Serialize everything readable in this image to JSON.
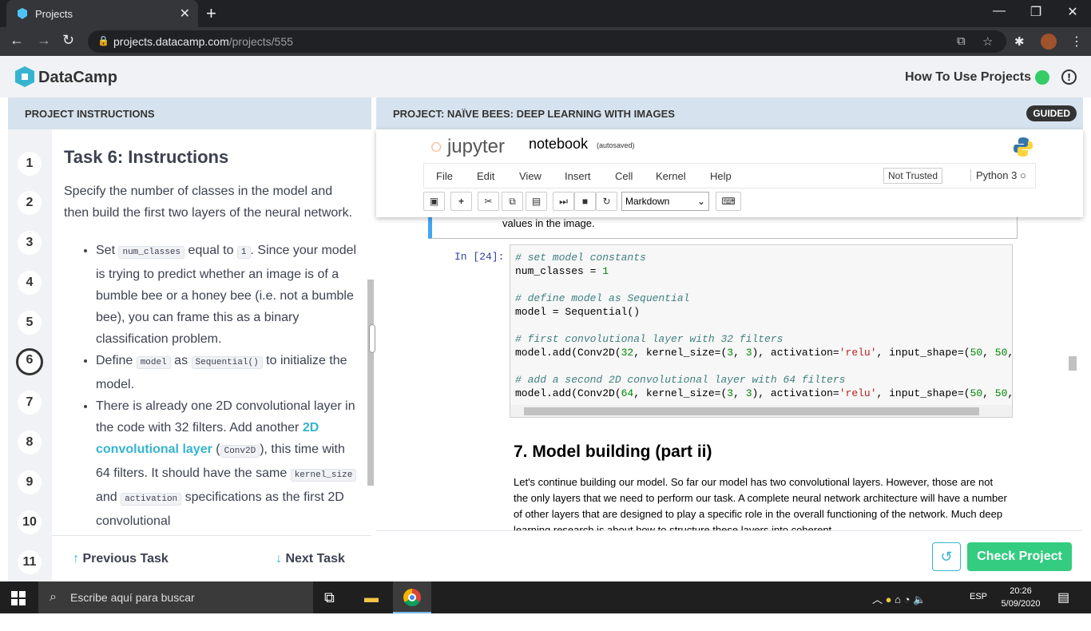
{
  "browser": {
    "tab_title": "Projects",
    "url_host": "projects.datacamp.com",
    "url_path": "/projects/555"
  },
  "header": {
    "brand": "DataCamp",
    "how_to": "How To Use Projects"
  },
  "left_panel": {
    "title": "PROJECT INSTRUCTIONS",
    "steps": [
      "1",
      "2",
      "3",
      "4",
      "5",
      "6",
      "7",
      "8",
      "9",
      "10",
      "11"
    ],
    "active_step": "6",
    "task_title": "Task 6: Instructions",
    "intro": "Specify the number of classes in the model and then build the first two layers of the neural network.",
    "bullets": {
      "b1_pre": "Set ",
      "b1_code1": "num_classes",
      "b1_mid": " equal to ",
      "b1_code2": "1",
      "b1_post": ". Since your model is trying to predict whether an image is of a bumble bee or a honey bee (i.e. not a bumble bee), you can frame this as a binary classification problem.",
      "b2_pre": "Define ",
      "b2_code1": "model",
      "b2_mid": " as ",
      "b2_code2": "Sequential()",
      "b2_post": " to initialize the model.",
      "b3_pre": "There is already one 2D convolutional layer in the code with 32 filters. Add another ",
      "b3_link": "2D convolutional layer",
      "b3_paren1": " (",
      "b3_code1": "Conv2D",
      "b3_mid": "), this time with 64 filters. It should have the same ",
      "b3_code2": "kernel_size",
      "b3_and": " and ",
      "b3_code3": "activation",
      "b3_post": " specifications as the first 2D convolutional"
    },
    "prev_label": "Previous Task",
    "next_label": "Next Task"
  },
  "right_panel": {
    "title": "PROJECT: NAÏVE BEES: DEEP LEARNING WITH IMAGES",
    "badge": "GUIDED",
    "jupyter": {
      "logo_text": "jupyter",
      "notebook_name": "notebook",
      "autosaved": "(autosaved)",
      "menu": [
        "File",
        "Edit",
        "View",
        "Insert",
        "Cell",
        "Kernel",
        "Help"
      ],
      "trusted": "Not Trusted",
      "kernel": "Python 3",
      "cell_type": "Markdown"
    },
    "prev_cell_text": "values in the image.",
    "prompt": "In [24]:",
    "code": {
      "l1": "# set model constants",
      "l2a": "num_classes = ",
      "l2b": "1",
      "l4": "# define model as Sequential",
      "l5": "model = Sequential()",
      "l7": "# first convolutional layer with 32 filters",
      "l8a": "model.add(Conv2D(",
      "l8b": "32",
      "l8c": ", kernel_size=(",
      "l8d": "3",
      "l8e": ", ",
      "l8f": "3",
      "l8g": "), activation=",
      "l8h": "'relu'",
      "l8i": ", input_shape=(",
      "l8j": "50",
      "l8k": ", ",
      "l8l": "50",
      "l8m": ",",
      "l10": "# add a second 2D convolutional layer with 64 filters",
      "l11b": "64"
    },
    "md_heading": "7. Model building (part ii)",
    "md_text": "Let's continue building our model. So far our model has two convolutional layers. However, those are not the only layers that we need to perform our task. A complete neural network architecture will have a number of other layers that are designed to play a specific role in the overall functioning of the network. Much deep learning research is about how to structure these layers into coherent",
    "check_label": "Check Project"
  },
  "taskbar": {
    "search_placeholder": "Escribe aquí para buscar",
    "lang": "ESP",
    "time": "20:26",
    "date": "5/09/2020"
  },
  "colors": {
    "accent_green": "#33cc80",
    "link_blue": "#36b4cf",
    "panel_header": "#d6e3ee"
  }
}
